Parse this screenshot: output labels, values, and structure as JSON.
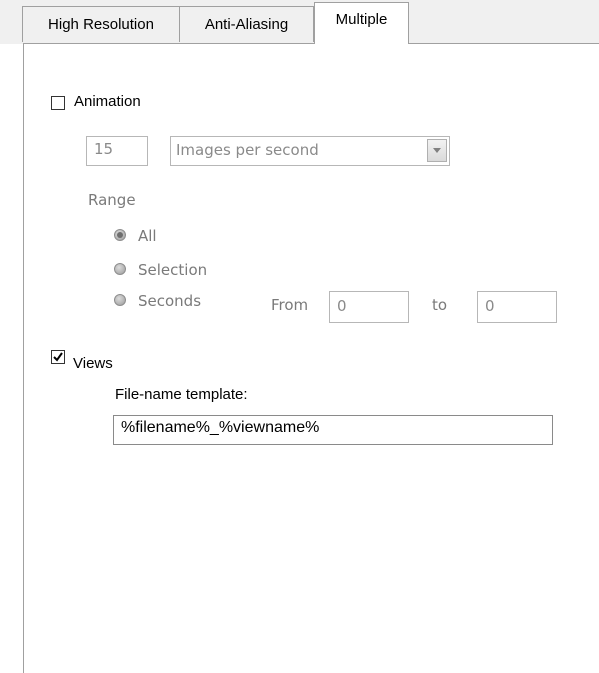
{
  "tabs": [
    {
      "label": "High Resolution",
      "active": false
    },
    {
      "label": "Anti-Aliasing",
      "active": false
    },
    {
      "label": "Multiple",
      "active": true
    }
  ],
  "animation": {
    "checkbox_label": "Animation",
    "checked": false,
    "rate_value": "15",
    "rate_unit_selected": "Images per second",
    "range_label": "Range",
    "range_options": [
      {
        "label": "All",
        "selected": true
      },
      {
        "label": "Selection",
        "selected": false
      },
      {
        "label": "Seconds",
        "selected": false
      }
    ],
    "from_label": "From",
    "from_value": "0",
    "to_label": "to",
    "to_value": "0"
  },
  "views": {
    "checkbox_label": "Views",
    "checked": true,
    "template_label": "File-name template:",
    "template_value": "%filename%_%viewname%"
  }
}
